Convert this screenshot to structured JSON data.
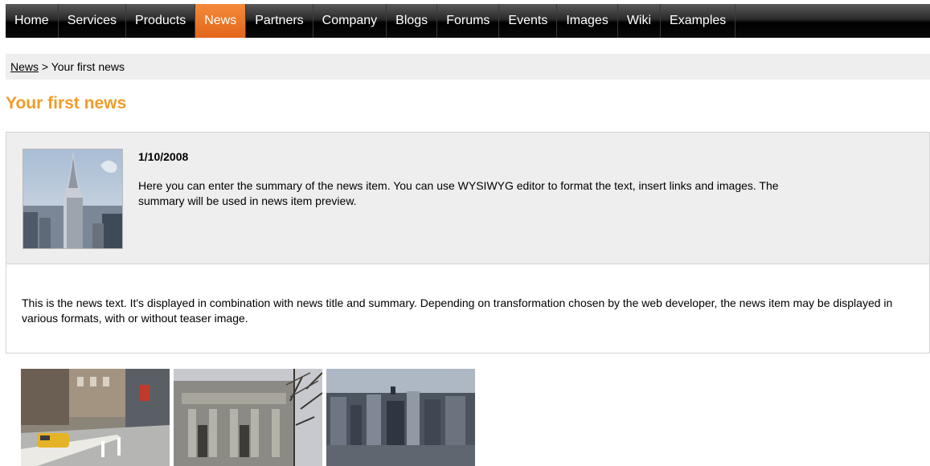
{
  "nav": {
    "items": [
      {
        "label": "Home",
        "active": false
      },
      {
        "label": "Services",
        "active": false
      },
      {
        "label": "Products",
        "active": false
      },
      {
        "label": "News",
        "active": true
      },
      {
        "label": "Partners",
        "active": false
      },
      {
        "label": "Company",
        "active": false
      },
      {
        "label": "Blogs",
        "active": false
      },
      {
        "label": "Forums",
        "active": false
      },
      {
        "label": "Events",
        "active": false
      },
      {
        "label": "Images",
        "active": false
      },
      {
        "label": "Wiki",
        "active": false
      },
      {
        "label": "Examples",
        "active": false
      }
    ]
  },
  "breadcrumb": {
    "link": "News",
    "separator": " > ",
    "current": "Your first news"
  },
  "article": {
    "title": "Your first news",
    "date": "1/10/2008",
    "summary": "Here you can enter the summary of the news item. You can use WYSIWYG editor to format the text, insert links and images. The summary will be used in news item preview.",
    "body": "This is the news text. It's displayed in combination with news title and summary. Depending on transformation chosen by the web developer, the news item may be displayed in various formats, with or without teaser image."
  },
  "colors": {
    "accent": "#f29b29",
    "active_tab": "#e8701f",
    "nav_bg": "#000000",
    "panel_bg": "#eeeeee"
  }
}
